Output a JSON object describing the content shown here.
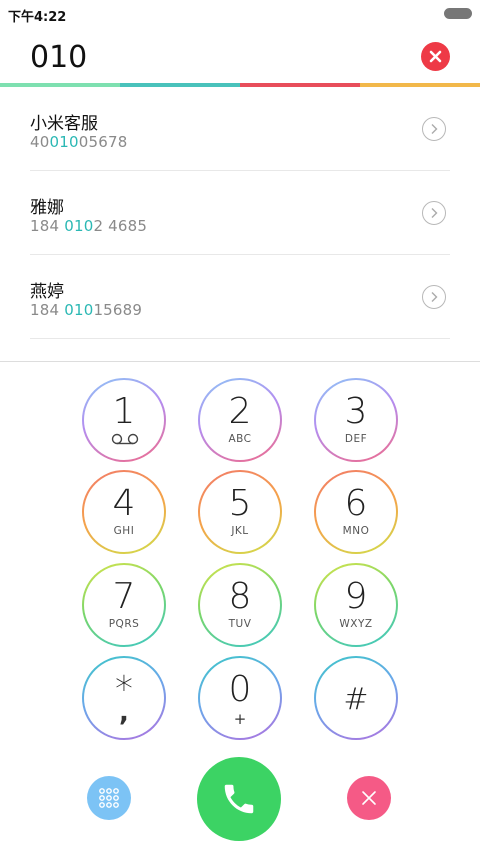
{
  "status": {
    "time": "下午4:22"
  },
  "dialer": {
    "number": "010"
  },
  "accent_colors": [
    "#7ee0b0",
    "#49c2bb",
    "#e84d5b",
    "#f2b84a"
  ],
  "contacts": [
    {
      "name": "小米客服",
      "num_pre": "40",
      "num_match": "010",
      "num_post": "05678"
    },
    {
      "name": "雅娜",
      "num_pre": "184 ",
      "num_match": "010",
      "num_post": "2 4685"
    },
    {
      "name": "燕婷",
      "num_pre": "184 ",
      "num_match": "010",
      "num_post": "15689"
    }
  ],
  "keys": [
    {
      "digit": "1",
      "letters": "",
      "sub": "voicemail"
    },
    {
      "digit": "2",
      "letters": "ABC"
    },
    {
      "digit": "3",
      "letters": "DEF"
    },
    {
      "digit": "4",
      "letters": "GHI"
    },
    {
      "digit": "5",
      "letters": "JKL"
    },
    {
      "digit": "6",
      "letters": "MNO"
    },
    {
      "digit": "7",
      "letters": "PQRS"
    },
    {
      "digit": "8",
      "letters": "TUV"
    },
    {
      "digit": "9",
      "letters": "WXYZ"
    },
    {
      "digit": "*",
      "letters": "",
      "sub": ","
    },
    {
      "digit": "0",
      "letters": "",
      "sub": "+"
    },
    {
      "digit": "#",
      "letters": ""
    }
  ],
  "icons": {
    "clear": "close-icon",
    "chevron": "chevron-right-icon",
    "keypad": "dialpad-grid-icon",
    "call": "phone-icon",
    "dismiss": "close-icon",
    "voicemail": "voicemail-icon"
  },
  "colors": {
    "clear_button": "#ee3a46",
    "keypad_button": "#7cc3f5",
    "call_button": "#3cd364",
    "dismiss_button": "#f55a86",
    "match_highlight": "#2bb8b4"
  }
}
